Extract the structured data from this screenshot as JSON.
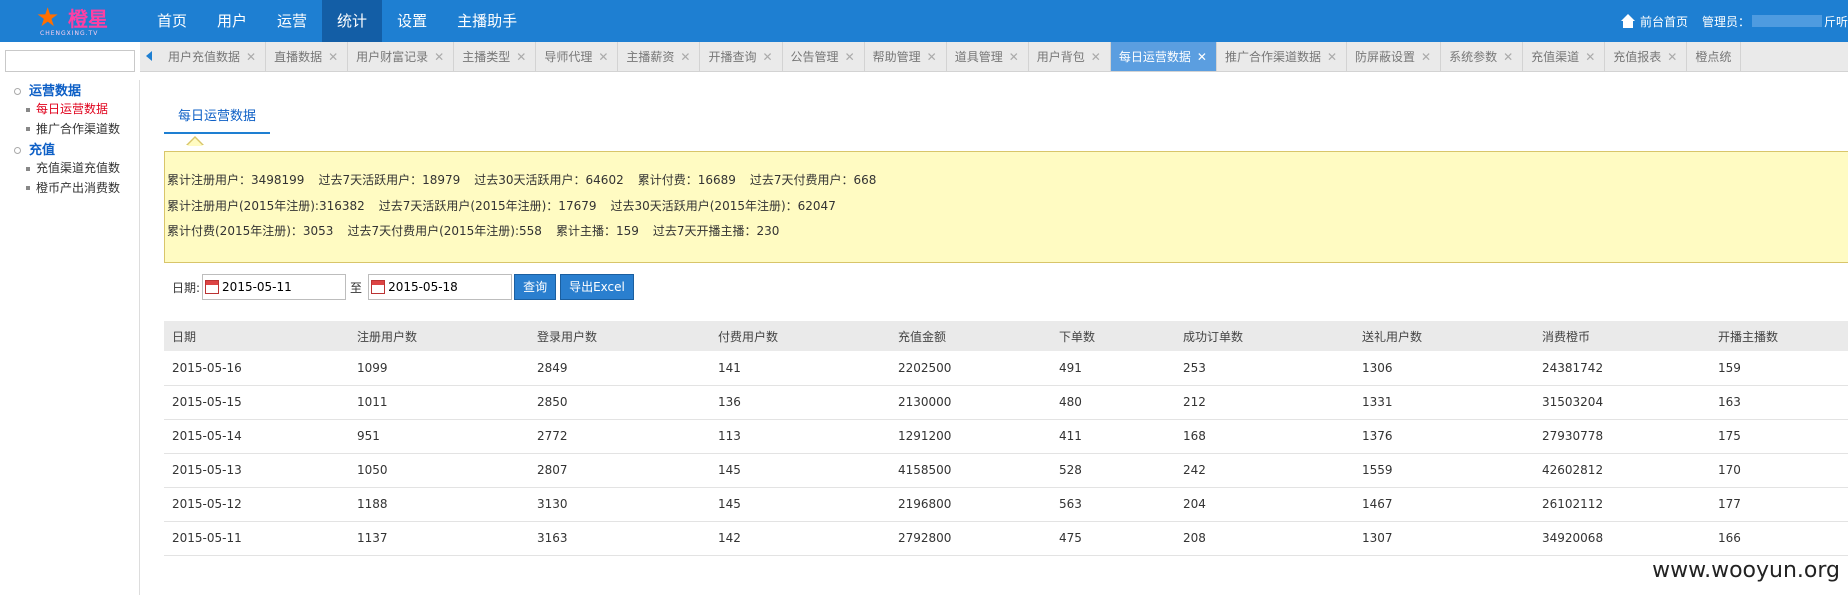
{
  "logo": {
    "text": "橙星",
    "sub": "CHENGXING.TV"
  },
  "nav": [
    "首页",
    "用户",
    "运营",
    "统计",
    "设置",
    "主播助手"
  ],
  "nav_active": 3,
  "top_right": {
    "home": "前台首页",
    "admin_prefix": "管理员：",
    "admin_suffix": "斤听"
  },
  "search": {
    "placeholder": ""
  },
  "sidebar": {
    "groups": [
      {
        "label": "运营数据",
        "items": [
          "每日运营数据",
          "推广合作渠道数"
        ]
      },
      {
        "label": "充值",
        "items": [
          "充值渠道充值数",
          "橙币产出消费数"
        ]
      }
    ]
  },
  "tabs": [
    "用户充值数据",
    "直播数据",
    "用户财富记录",
    "主播类型",
    "导师代理",
    "主播薪资",
    "开播查询",
    "公告管理",
    "帮助管理",
    "道具管理",
    "用户背包",
    "每日运营数据",
    "推广合作渠道数据",
    "防屏蔽设置",
    "系统参数",
    "充值渠道",
    "充值报表",
    "橙点统"
  ],
  "tab_active": 11,
  "content_tab": "每日运营数据",
  "stats": [
    [
      "累计注册用户：3498199",
      "过去7天活跃用户：18979",
      "过去30天活跃用户：64602",
      "累计付费：16689",
      "过去7天付费用户：668"
    ],
    [
      "累计注册用户(2015年注册):316382",
      "过去7天活跃用户(2015年注册)：17679",
      "过去30天活跃用户(2015年注册)：62047"
    ],
    [
      "累计付费(2015年注册)：3053",
      "过去7天付费用户(2015年注册):558",
      "累计主播：159",
      "过去7天开播主播：230"
    ]
  ],
  "filter": {
    "label": "日期:",
    "start": "2015-05-11",
    "sep": "至",
    "end": "2015-05-18",
    "query": "查询",
    "export": "导出Excel"
  },
  "table": {
    "headers": [
      "日期",
      "注册用户数",
      "登录用户数",
      "付费用户数",
      "充值金额",
      "下单数",
      "成功订单数",
      "送礼用户数",
      "消费橙币",
      "开播主播数"
    ],
    "rows": [
      [
        "2015-05-16",
        "1099",
        "2849",
        "141",
        "2202500",
        "491",
        "253",
        "1306",
        "24381742",
        "159"
      ],
      [
        "2015-05-15",
        "1011",
        "2850",
        "136",
        "2130000",
        "480",
        "212",
        "1331",
        "31503204",
        "163"
      ],
      [
        "2015-05-14",
        "951",
        "2772",
        "113",
        "1291200",
        "411",
        "168",
        "1376",
        "27930778",
        "175"
      ],
      [
        "2015-05-13",
        "1050",
        "2807",
        "145",
        "4158500",
        "528",
        "242",
        "1559",
        "42602812",
        "170"
      ],
      [
        "2015-05-12",
        "1188",
        "3130",
        "145",
        "2196800",
        "563",
        "204",
        "1467",
        "26102112",
        "177"
      ],
      [
        "2015-05-11",
        "1137",
        "3163",
        "142",
        "2792800",
        "475",
        "208",
        "1307",
        "34920068",
        "166"
      ]
    ]
  },
  "watermark": "www.wooyun.org",
  "colors": {
    "nav_bg": "#1e7fd2",
    "nav_active": "#135ea6",
    "tab_active": "#5b9ee0",
    "notice_bg": "#fffbc2",
    "link": "#0d5fc6",
    "sidebar_active": "#e0001b"
  }
}
